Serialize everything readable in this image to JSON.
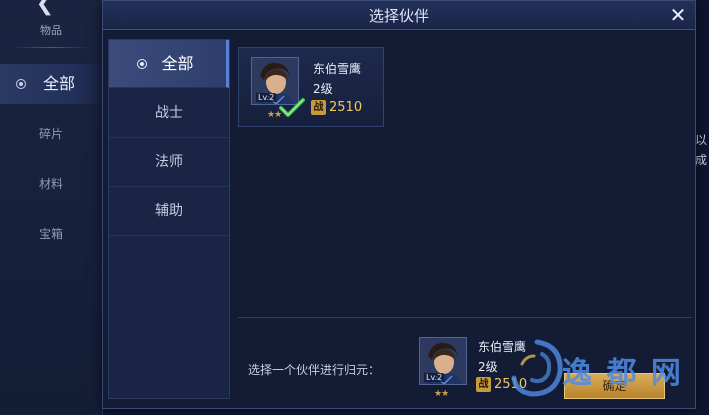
{
  "background": {
    "section_title": "物品",
    "items": [
      {
        "label": "全部",
        "active": true
      },
      {
        "label": "碎片",
        "active": false
      },
      {
        "label": "材料",
        "active": false
      },
      {
        "label": "宝箱",
        "active": false
      }
    ],
    "right_text_1": "以",
    "right_text_2": "成"
  },
  "modal": {
    "title": "选择伙伴",
    "close_icon": "close-icon",
    "tabs": [
      {
        "label": "全部",
        "active": true
      },
      {
        "label": "战士",
        "active": false
      },
      {
        "label": "法师",
        "active": false
      },
      {
        "label": "辅助",
        "active": false
      }
    ],
    "partners": [
      {
        "name": "东伯雪鹰",
        "level": "2级",
        "lv_badge": "Lv.2",
        "power_icon": "战",
        "power": "2510",
        "stars": "★★",
        "selected": true
      }
    ],
    "bottom": {
      "prompt": "选择一个伙伴进行归元：",
      "name": "东伯雪鹰",
      "level": "2级",
      "lv_badge": "Lv.2",
      "power_icon": "战",
      "power": "2510",
      "stars": "★★",
      "confirm_label": "确定"
    }
  },
  "watermark": {
    "text": "逸 都 网"
  },
  "colors": {
    "accent_gold": "#f0c960",
    "button_gold": "#d9ad58",
    "panel_blue": "#131c34"
  }
}
